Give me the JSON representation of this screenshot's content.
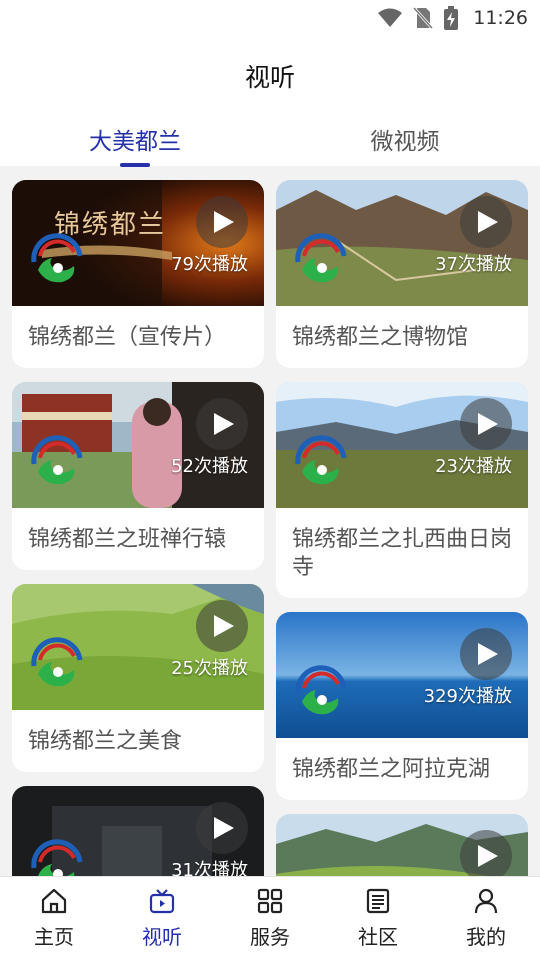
{
  "status_bar": {
    "time": "11:26"
  },
  "header": {
    "title": "视听"
  },
  "tabs": [
    {
      "label": "大美都兰",
      "active": true
    },
    {
      "label": "微视频",
      "active": false
    }
  ],
  "left_cards": [
    {
      "title": "锦绣都兰（宣传片）",
      "plays": "79次播放",
      "overlay_text": "锦绣都兰"
    },
    {
      "title": "锦绣都兰之班禅行辕",
      "plays": "52次播放"
    },
    {
      "title": "锦绣都兰之美食",
      "plays": "25次播放"
    },
    {
      "title": "",
      "plays": "31次播放"
    }
  ],
  "right_cards": [
    {
      "title": "锦绣都兰之博物馆",
      "plays": "37次播放"
    },
    {
      "title": "锦绣都兰之扎西曲日岗寺",
      "plays": "23次播放"
    },
    {
      "title": "锦绣都兰之阿拉克湖",
      "plays": "329次播放"
    },
    {
      "title": "",
      "plays": ""
    }
  ],
  "bottom_nav": [
    {
      "label": "主页",
      "icon": "home-icon",
      "active": false
    },
    {
      "label": "视听",
      "icon": "tv-icon",
      "active": true
    },
    {
      "label": "服务",
      "icon": "grid-icon",
      "active": false
    },
    {
      "label": "社区",
      "icon": "newspaper-icon",
      "active": false
    },
    {
      "label": "我的",
      "icon": "user-icon",
      "active": false
    }
  ],
  "colors": {
    "accent": "#2531a8",
    "background": "#f2f2f2"
  }
}
